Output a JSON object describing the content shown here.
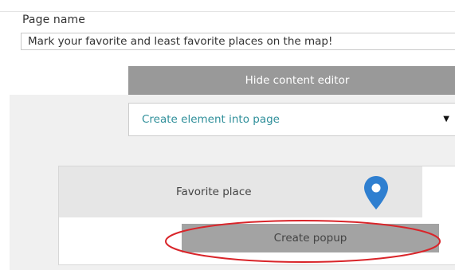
{
  "page_name": {
    "label": "Page name",
    "value": "Mark your favorite and least favorite places on the map!"
  },
  "editor": {
    "hide_button_label": "Hide content editor",
    "create_select": {
      "selected": "Create element into page",
      "arrow_glyph": "▼"
    }
  },
  "element": {
    "marker_label": "Favorite place",
    "marker_icon": "map-pin-icon",
    "marker_color": "#2f7fd0",
    "create_popup_label": "Create popup"
  },
  "annotation": {
    "color": "#d9252a"
  }
}
